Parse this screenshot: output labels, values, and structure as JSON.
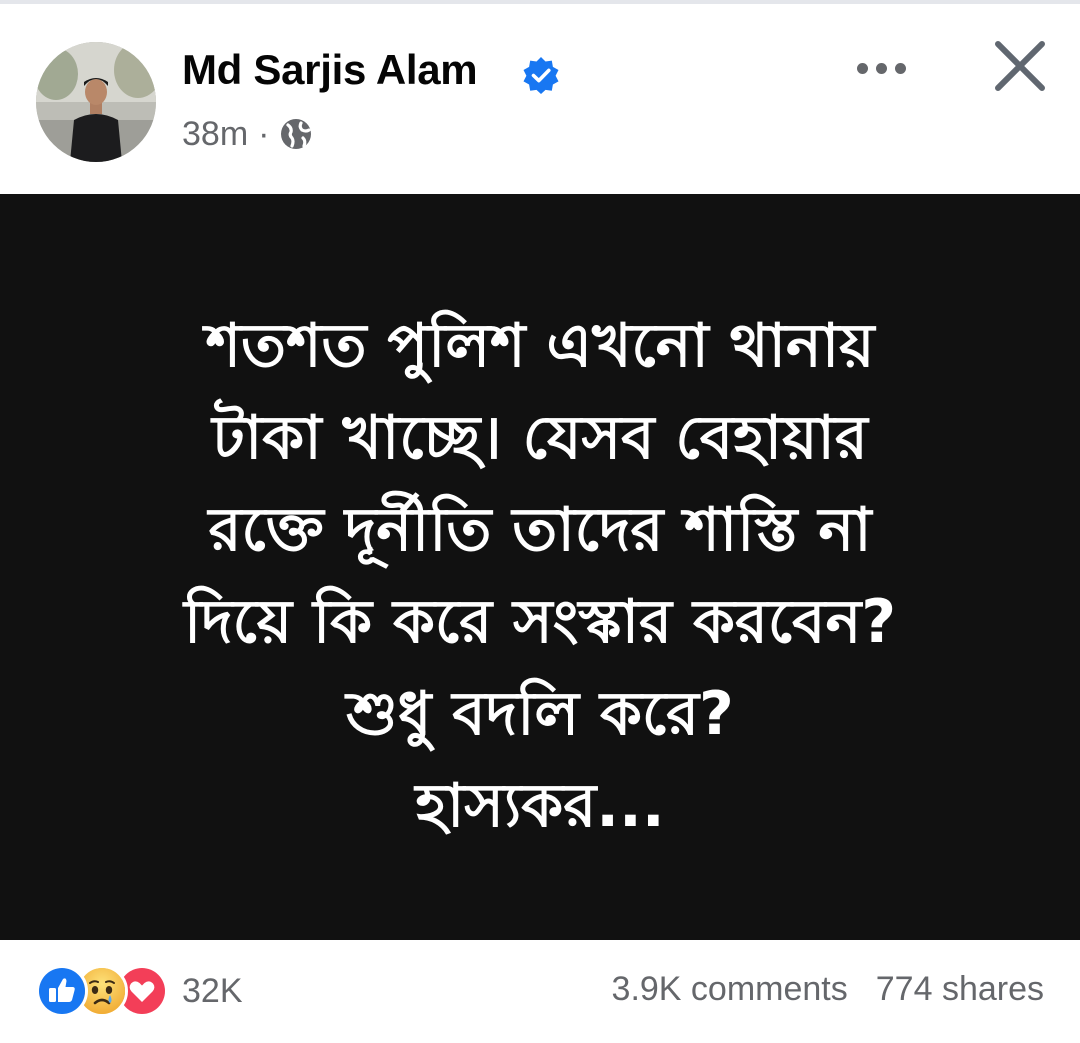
{
  "post": {
    "author": "Md Sarjis Alam",
    "verified": true,
    "time": "38m",
    "separator": "·",
    "audience_icon": "globe-icon",
    "body_lines": [
      "শতশত পুলিশ এখনো থানায়",
      "টাকা খাচ্ছে। যেসব বেহায়ার",
      "রক্তে দূর্নীতি তাদের শাস্তি না",
      "দিয়ে কি করে সংস্কার করবেন?",
      "শুধু বদলি করে?",
      "হাস্যকর..."
    ]
  },
  "footer": {
    "reactions": [
      "like-icon",
      "sad-icon",
      "love-icon"
    ],
    "reaction_count": "32K",
    "comments": "3.9K comments",
    "shares": "774 shares"
  },
  "colors": {
    "verified": "#1877f2",
    "like": "#1877f2",
    "love": "#f33e58",
    "post_background": "#111111",
    "secondary_text": "#65676b"
  }
}
